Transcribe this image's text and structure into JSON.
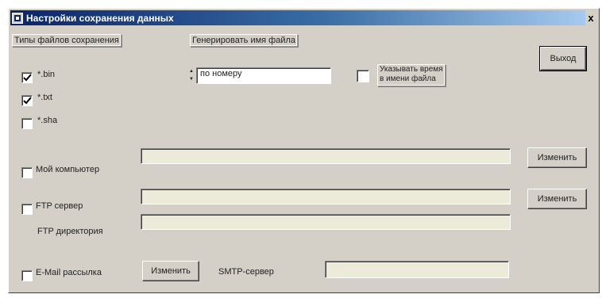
{
  "window": {
    "title": "Настройки сохранения данных",
    "close_label": "x"
  },
  "file_types": {
    "group_label": "Типы файлов сохранения",
    "items": [
      {
        "label": "*.bin",
        "checked": true
      },
      {
        "label": "*.txt",
        "checked": true
      },
      {
        "label": "*.sha",
        "checked": false
      }
    ]
  },
  "filename": {
    "group_label": "Генерировать имя файла",
    "value": "по номеру",
    "time_option": {
      "label": "Указывать время\nв имени файла",
      "checked": false
    }
  },
  "exit_button": "Выход",
  "my_computer": {
    "label": "Мой компьютер",
    "checked": false,
    "path": "",
    "change_button": "Изменить"
  },
  "ftp": {
    "label": "FTP сервер",
    "checked": false,
    "server": "",
    "dir_label": "FTP директория",
    "dir": "",
    "change_button": "Изменить"
  },
  "email": {
    "label": "E-Mail рассылка",
    "checked": false,
    "change_button": "Изменить",
    "smtp_label": "SMTP-сервер",
    "smtp": ""
  }
}
